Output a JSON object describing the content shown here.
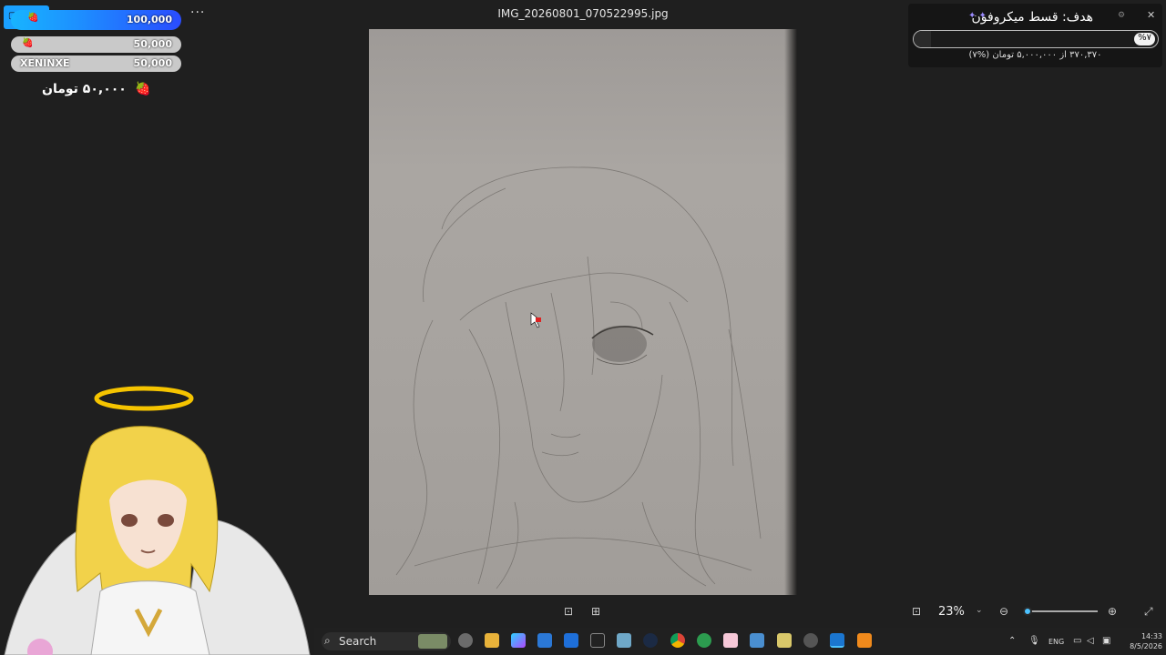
{
  "viewer": {
    "filename": "IMG_20260801_070522995.jpg",
    "more_label": "···",
    "zoom": "23%",
    "zoom_fraction": 0.03
  },
  "donations": {
    "top": {
      "amount": "100,000"
    },
    "rows": [
      {
        "name": "",
        "amount": "50,000"
      },
      {
        "name": "XENINXE",
        "amount": "50,000"
      }
    ],
    "total": "۵۰,۰۰۰ تومان",
    "icon": "strawberry-icon"
  },
  "goal": {
    "title": "هدف: قسط میکروفون",
    "percent_badge": "%۷",
    "progress_fraction": 0.07,
    "subtitle": "۳۷۰,۳۷۰ از ۵,۰۰۰,۰۰۰ تومان (%۷)"
  },
  "taskbar": {
    "search_label": "Search",
    "language": "ENG",
    "time": "14:33",
    "date": "8/5/2026"
  }
}
